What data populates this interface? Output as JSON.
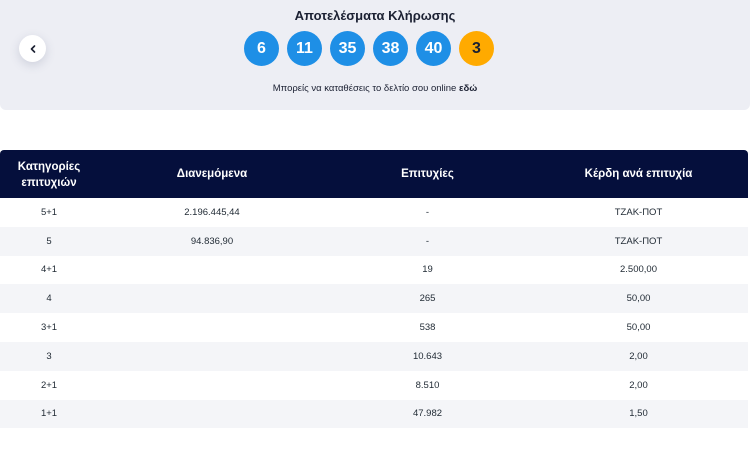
{
  "colors": {
    "panel_background": "#edeef4",
    "number_ball": "#1e8fe6",
    "bonus_ball": "#ffaa00",
    "table_header": "#050f3c"
  },
  "header": {
    "back_icon": "chevron-left-icon",
    "title": "Αποτελέσματα Κλήρωσης",
    "numbers": [
      "6",
      "11",
      "35",
      "38",
      "40"
    ],
    "bonus": "3",
    "note_prefix": "Μπορείς να καταθέσεις το δελτίο σου online",
    "note_link": "εδώ"
  },
  "table": {
    "columns": {
      "category_line1": "Κατηγορίες",
      "category_line2": "επιτυχιών",
      "distributed": "Διανεμόμενα",
      "winners": "Επιτυχίες",
      "payout": "Κέρδη ανά επιτυχία"
    },
    "rows": [
      {
        "category": "5+1",
        "distributed": "2.196.445,44",
        "winners": "-",
        "payout": "ΤΖΑΚ-ΠΟΤ"
      },
      {
        "category": "5",
        "distributed": "94.836,90",
        "winners": "-",
        "payout": "ΤΖΑΚ-ΠΟΤ"
      },
      {
        "category": "4+1",
        "distributed": "",
        "winners": "19",
        "payout": "2.500,00"
      },
      {
        "category": "4",
        "distributed": "",
        "winners": "265",
        "payout": "50,00"
      },
      {
        "category": "3+1",
        "distributed": "",
        "winners": "538",
        "payout": "50,00"
      },
      {
        "category": "3",
        "distributed": "",
        "winners": "10.643",
        "payout": "2,00"
      },
      {
        "category": "2+1",
        "distributed": "",
        "winners": "8.510",
        "payout": "2,00"
      },
      {
        "category": "1+1",
        "distributed": "",
        "winners": "47.982",
        "payout": "1,50"
      }
    ]
  }
}
